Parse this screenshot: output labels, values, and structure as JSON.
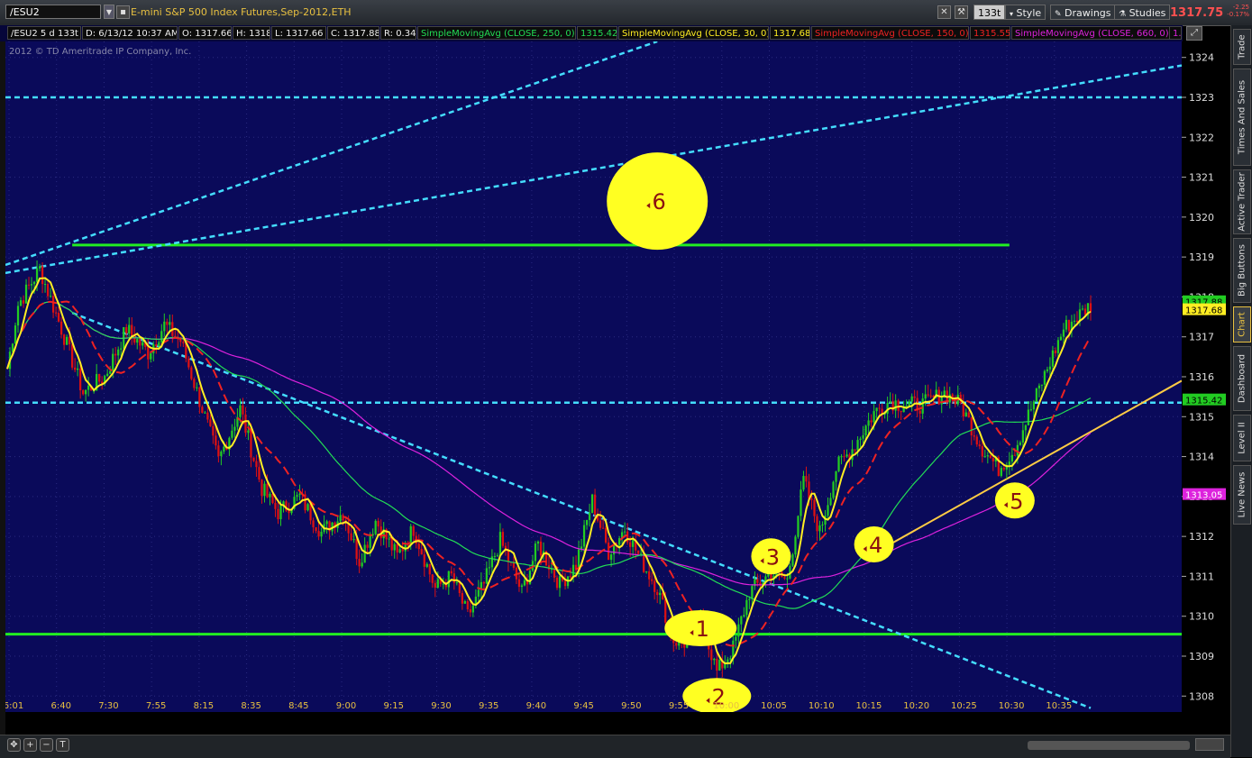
{
  "toolbar": {
    "symbol": "/ESU2",
    "description": "E-mini S&P 500 Index Futures,Sep-2012,ETH",
    "tick_agg": "133t",
    "style_label": "Style",
    "drawings_label": "Drawings",
    "studies_label": "Studies",
    "last_price": "1317.75",
    "change_abs": "-2.25",
    "change_pct": "-0.17%"
  },
  "infobar": {
    "symbol_period": "/ESU2 5 d 133t",
    "date": "D: 6/13/12 10:37 AM",
    "open": "O: 1317.66",
    "high": "H: 1318",
    "low": "L: 1317.66",
    "close": "C: 1317.88",
    "range": "R: 0.34",
    "sma250_label": "SimpleMovingAvg (CLOSE, 250, 0)",
    "sma250_value": "1315.42",
    "sma30_label": "SimpleMovingAvg (CLOSE, 30, 0)",
    "sma30_value": "1317.68",
    "sma150_label": "SimpleMovingAvg (CLOSE, 150, 0)",
    "sma150_value": "1315.55",
    "sma660_label": "SimpleMovingAvg (CLOSE, 660, 0)",
    "more": "1."
  },
  "copyright": "2012 © TD Ameritrade IP Company, Inc.",
  "sidebar": {
    "tabs": [
      "Trade",
      "Times And Sales",
      "Active Trader",
      "Big Buttons",
      "Chart",
      "Dashboard",
      "Level II",
      "Live News"
    ]
  },
  "colors": {
    "background": "#0a0a5a",
    "up": "#22cc22",
    "down": "#dd1111",
    "sma30": "#ffee22",
    "sma150": "#ee2222",
    "sma250": "#22dd55",
    "sma660": "#dd22dd",
    "cyan_lines": "#44ddff",
    "support": "#22ee22",
    "trend": "#ffcc44",
    "marker": "#ffff22"
  },
  "chart_data": {
    "type": "candlestick",
    "ylim": [
      1307.6,
      1324.4
    ],
    "y_ticks": [
      1308,
      1309,
      1310,
      1311,
      1312,
      1313,
      1314,
      1315,
      1316,
      1317,
      1318,
      1319,
      1320,
      1321,
      1322,
      1323,
      1324
    ],
    "x_ticks": [
      "6:01",
      "6:40",
      "7:30",
      "7:55",
      "8:15",
      "8:35",
      "8:45",
      "9:00",
      "9:15",
      "9:30",
      "9:35",
      "9:40",
      "9:45",
      "9:50",
      "9:55",
      "10:00",
      "10:05",
      "10:10",
      "10:15",
      "10:20",
      "10:25",
      "10:30",
      "10:35"
    ],
    "price_path": [
      [
        0,
        1316.2
      ],
      [
        4,
        1317.8
      ],
      [
        12,
        1318.7
      ],
      [
        20,
        1317.2
      ],
      [
        28,
        1315.6
      ],
      [
        36,
        1316.0
      ],
      [
        44,
        1317.2
      ],
      [
        52,
        1316.6
      ],
      [
        58,
        1317.3
      ],
      [
        64,
        1316.9
      ],
      [
        72,
        1315.2
      ],
      [
        78,
        1313.9
      ],
      [
        86,
        1315.2
      ],
      [
        94,
        1313.2
      ],
      [
        100,
        1312.6
      ],
      [
        108,
        1313.0
      ],
      [
        116,
        1312.1
      ],
      [
        124,
        1312.6
      ],
      [
        130,
        1311.4
      ],
      [
        136,
        1312.4
      ],
      [
        144,
        1311.5
      ],
      [
        150,
        1312.2
      ],
      [
        158,
        1310.7
      ],
      [
        164,
        1311.0
      ],
      [
        170,
        1310.0
      ],
      [
        176,
        1310.8
      ],
      [
        182,
        1311.9
      ],
      [
        190,
        1310.6
      ],
      [
        196,
        1311.8
      ],
      [
        204,
        1310.8
      ],
      [
        210,
        1311.3
      ],
      [
        216,
        1312.9
      ],
      [
        222,
        1311.6
      ],
      [
        228,
        1312.2
      ],
      [
        234,
        1311.4
      ],
      [
        240,
        1310.7
      ],
      [
        246,
        1309.4
      ],
      [
        252,
        1309.3
      ],
      [
        256,
        1310.0
      ],
      [
        262,
        1308.6
      ],
      [
        268,
        1309.2
      ],
      [
        274,
        1310.6
      ],
      [
        282,
        1311.1
      ],
      [
        288,
        1310.9
      ],
      [
        294,
        1313.4
      ],
      [
        300,
        1312.1
      ],
      [
        306,
        1313.7
      ],
      [
        312,
        1314.2
      ],
      [
        320,
        1315.1
      ],
      [
        326,
        1315.4
      ],
      [
        330,
        1315.3
      ],
      [
        338,
        1315.3
      ],
      [
        346,
        1315.6
      ],
      [
        352,
        1315.3
      ],
      [
        360,
        1314.2
      ],
      [
        366,
        1313.7
      ],
      [
        372,
        1314.2
      ],
      [
        378,
        1315.2
      ],
      [
        384,
        1316.2
      ],
      [
        390,
        1317.2
      ],
      [
        400,
        1317.8
      ]
    ],
    "total_bars": 400,
    "sma_periods": {
      "yellow": 6,
      "red": 20,
      "green": 60,
      "magenta": 120
    },
    "horizontal_levels": [
      {
        "price": 1309.55,
        "style": "solid",
        "color": "support"
      },
      {
        "price": 1319.3,
        "style": "solid",
        "color": "support",
        "from_bar": 24,
        "to_bar": 370
      },
      {
        "price": 1315.35,
        "style": "dashed",
        "color": "cyan_lines"
      },
      {
        "price": 1323.0,
        "style": "dashed",
        "color": "cyan_lines"
      }
    ],
    "markers": [
      {
        "label": "1",
        "bar": 256,
        "price": 1309.7
      },
      {
        "label": "2",
        "bar": 262,
        "price": 1308.0
      },
      {
        "label": "3",
        "bar": 282,
        "price": 1311.5
      },
      {
        "label": "4",
        "bar": 320,
        "price": 1311.8
      },
      {
        "label": "5",
        "bar": 372,
        "price": 1312.9
      },
      {
        "label": "6",
        "bar": 240,
        "price": 1320.4
      }
    ],
    "price_tags": [
      {
        "label": "1317.88",
        "price": 1317.88,
        "bg": "#22cc22",
        "fg": "#000"
      },
      {
        "label": "1317.68",
        "price": 1317.68,
        "bg": "#ffee22",
        "fg": "#000"
      },
      {
        "label": "1315.42",
        "price": 1315.42,
        "bg": "#22cc22",
        "fg": "#000"
      },
      {
        "label": "1313.05",
        "price": 1313.05,
        "bg": "#dd22dd",
        "fg": "#fff"
      }
    ]
  }
}
